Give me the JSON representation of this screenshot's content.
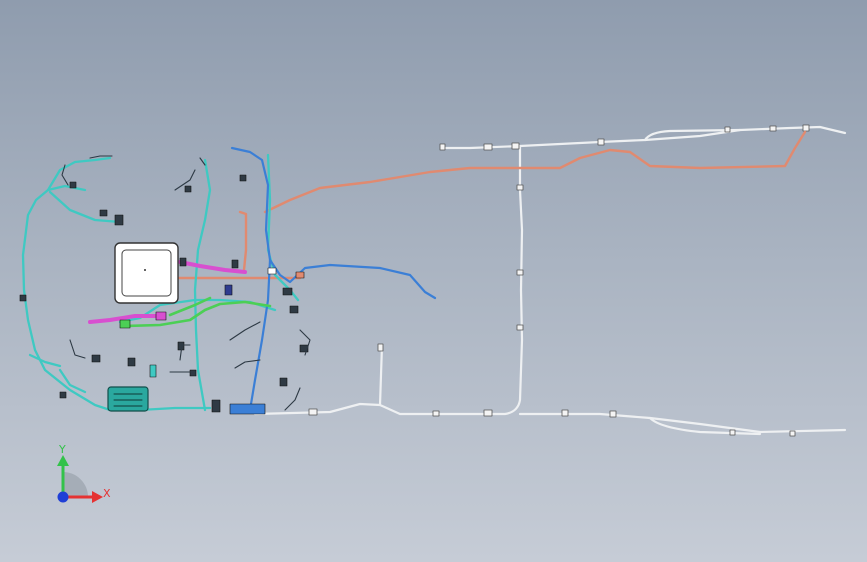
{
  "colors": {
    "background_top": "#8f9cae",
    "background_bottom": "#c6ccd6",
    "harness_cyan": "#3fc9c2",
    "harness_salmon": "#e08a70",
    "harness_magenta": "#d84fd0",
    "harness_green": "#4ccf55",
    "harness_blue": "#3b7fd6",
    "harness_grey": "#e6e8ea",
    "axis_y": "#33c24a",
    "axis_x": "#e53232",
    "axis_origin": "#1f3fd6"
  },
  "coordinate_triad": {
    "y_label": "Y",
    "x_label": "X",
    "icons": [
      "axis-y-arrow-icon",
      "axis-x-arrow-icon",
      "origin-dot-icon"
    ]
  },
  "model": {
    "description_icon": "wire-harness-assembly-icon"
  }
}
